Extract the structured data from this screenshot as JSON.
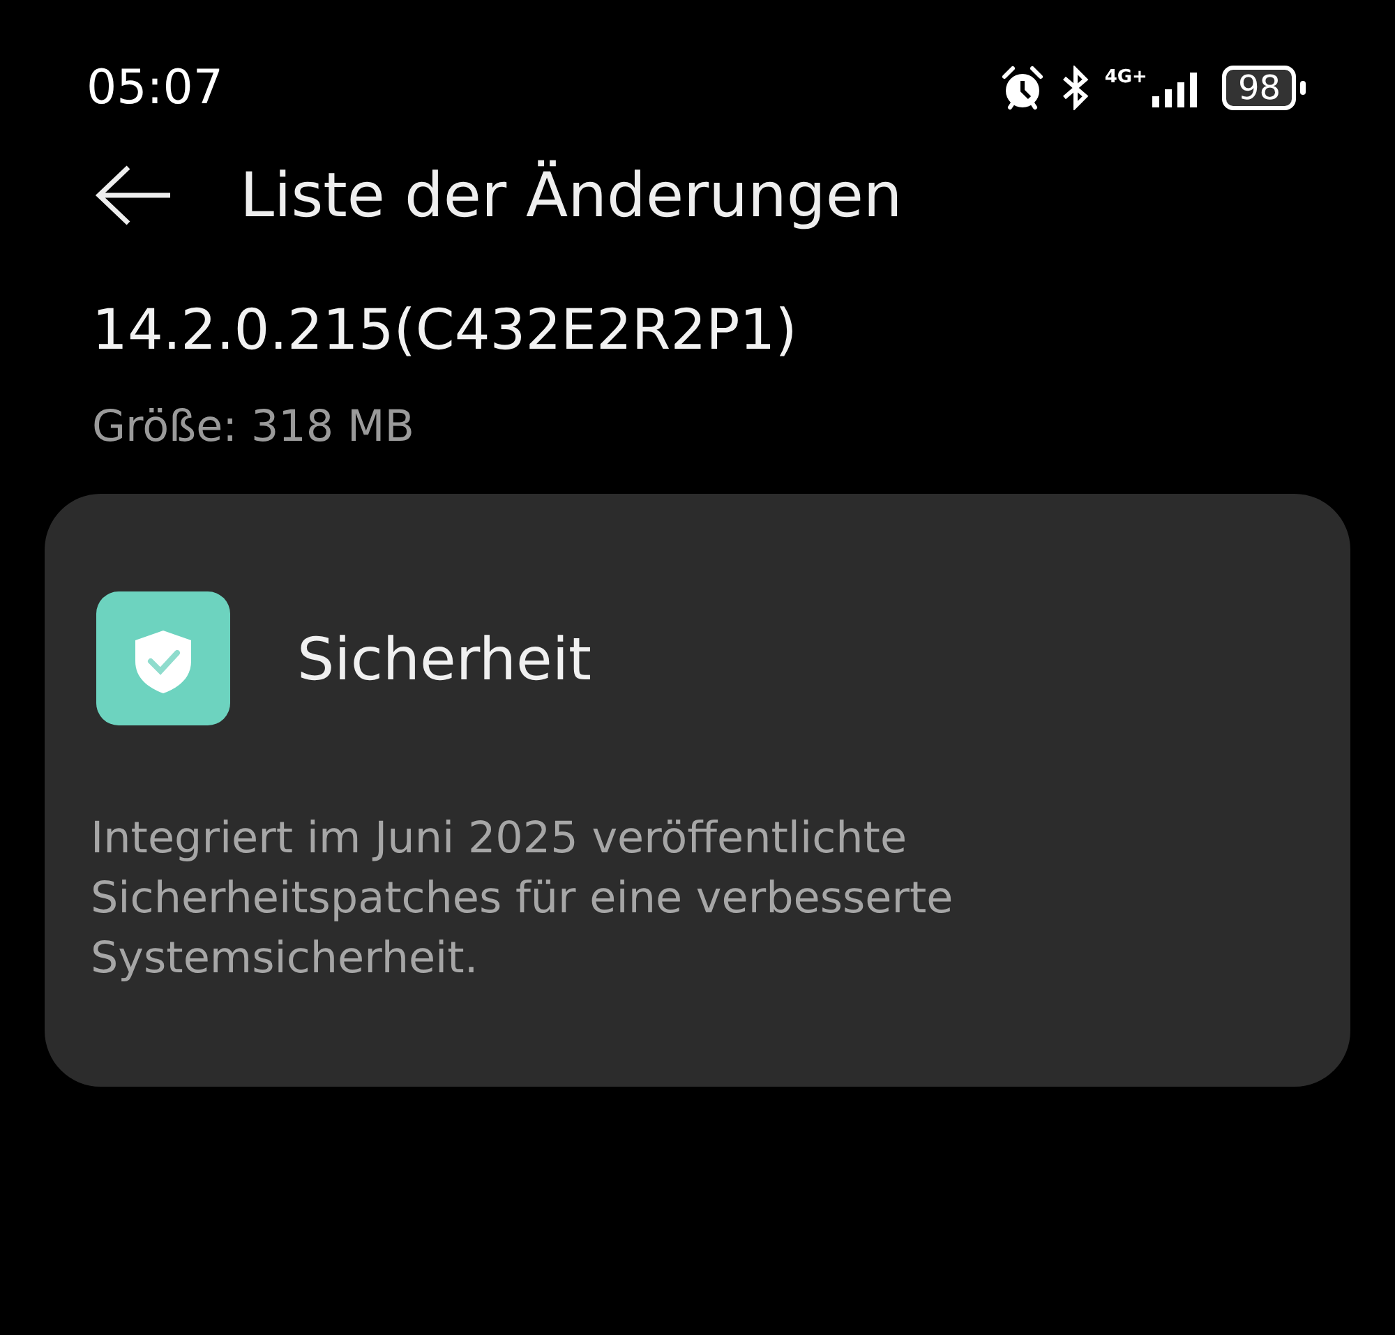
{
  "status_bar": {
    "time": "05:07",
    "network": "4G+",
    "battery": "98"
  },
  "header": {
    "title": "Liste der Änderungen"
  },
  "version": "14.2.0.215(C432E2R2P1)",
  "size": "Größe: 318 MB",
  "sections": [
    {
      "kind": "security",
      "title": "Sicherheit",
      "description": "Integriert im Juni 2025 veröffentlichte Sicherheitspatches für eine verbesserte Systemsicherheit."
    }
  ]
}
